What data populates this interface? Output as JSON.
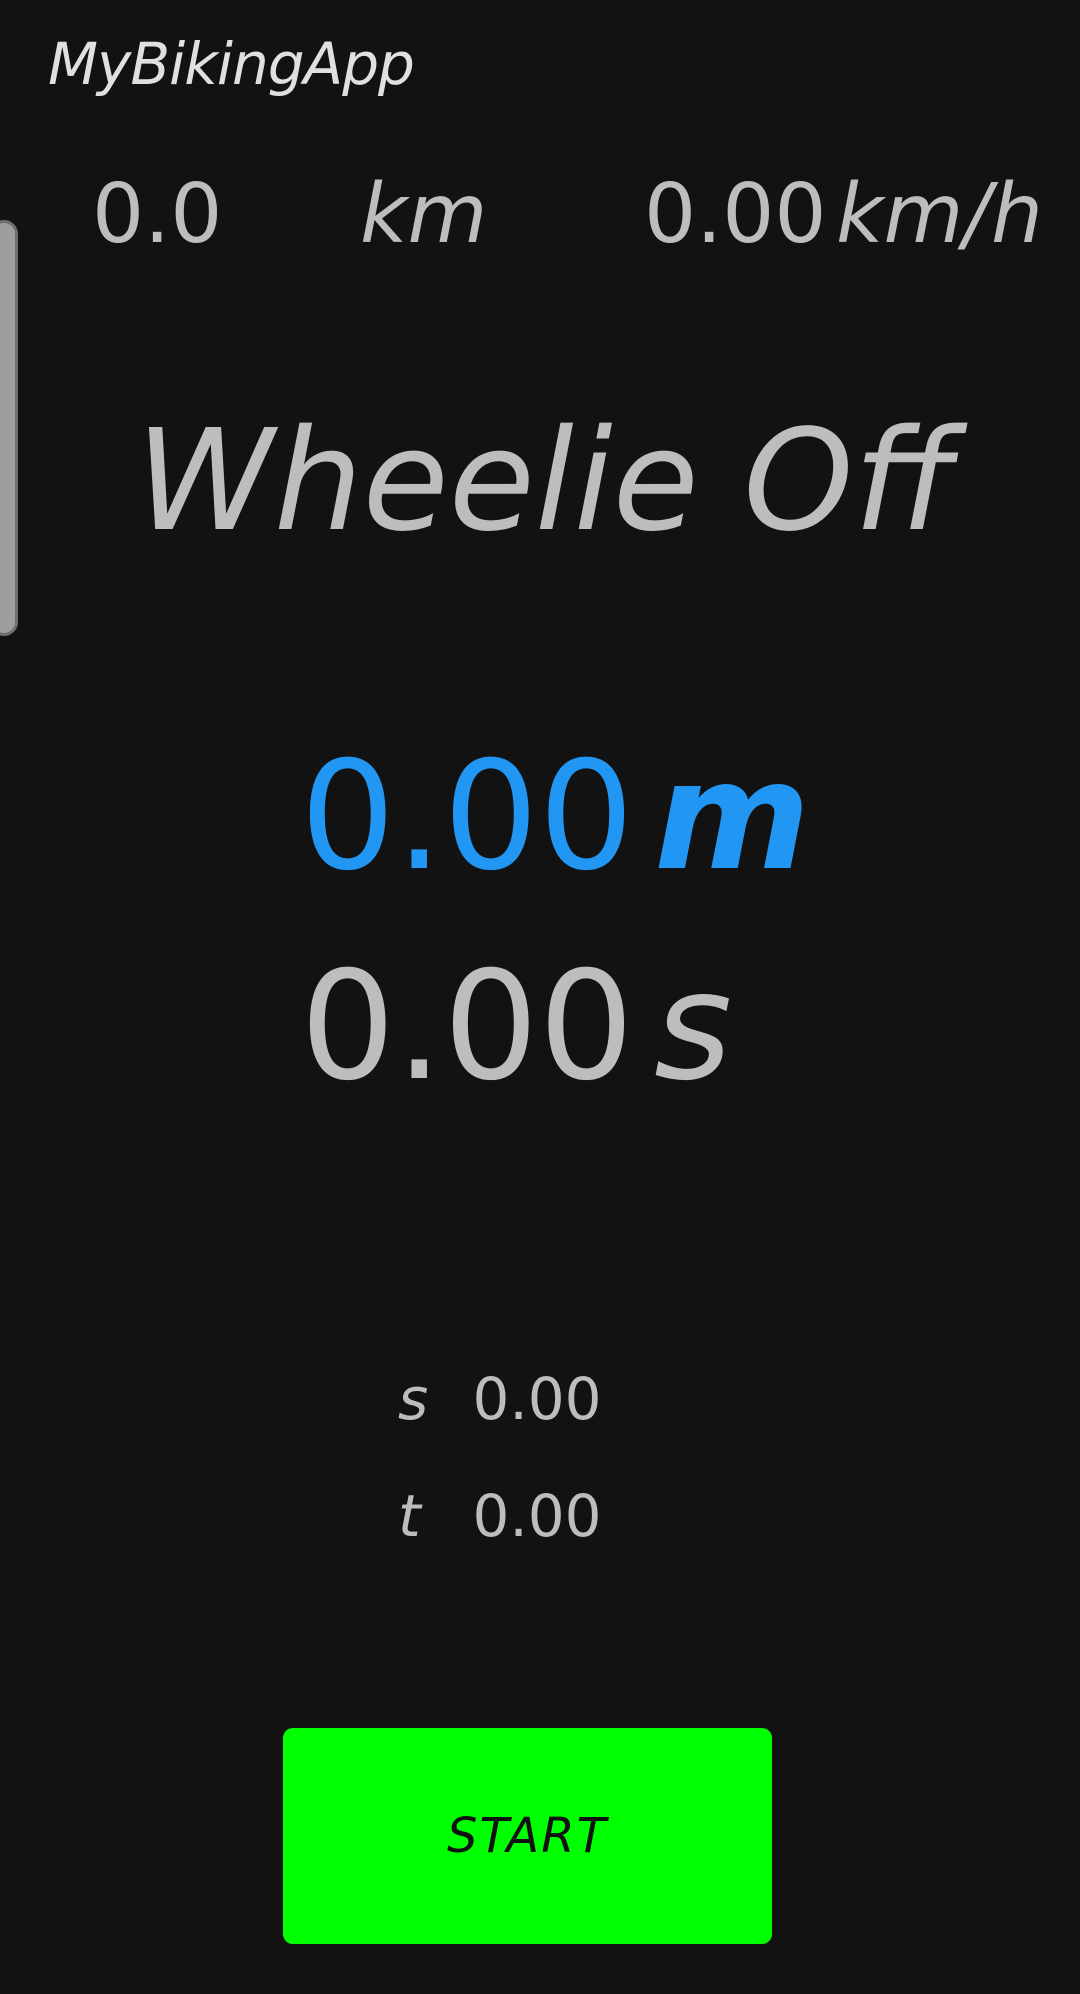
{
  "app": {
    "title": "MyBikingApp"
  },
  "stats": {
    "distance_value": "0.0",
    "distance_unit": "km",
    "speed_value": "0.00",
    "speed_unit": "km/h"
  },
  "wheelie": {
    "status": "Wheelie Off",
    "distance_value": "0.00",
    "distance_unit": "m",
    "time_value": "0.00",
    "time_unit": "s"
  },
  "details": {
    "s_label": "s",
    "s_value": "0.00",
    "t_label": "t",
    "t_value": "0.00"
  },
  "controls": {
    "start_label": "START"
  },
  "colors": {
    "background": "#121212",
    "text": "#bdbdbd",
    "accent_blue": "#2196f3",
    "start_green": "#00ff00"
  }
}
